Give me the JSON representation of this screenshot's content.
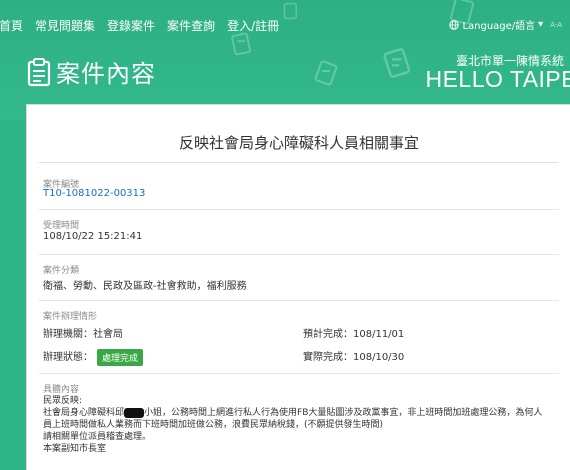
{
  "nav": {
    "items": [
      "首頁",
      "常見問題集",
      "登錄案件",
      "案件查詢",
      "登入/註冊"
    ],
    "language_label": "Language/語言",
    "language_arrow": "▾",
    "extra": "A-A"
  },
  "header": {
    "page_title": "案件內容",
    "city_small": "臺北市單一陳情系統",
    "city_big": "HELLO TAIPEI"
  },
  "case": {
    "title": "反映社會局身心障礙科人員相關事宜",
    "case_no_label": "案件編號",
    "case_no": "T10-1081022-00313",
    "received_label": "受理時間",
    "received": "108/10/22 15:21:41",
    "category_label": "案件分類",
    "category": "衛福、勞動、民政及區政-社會救助，福利服務",
    "handling_label": "案件辦理情形",
    "agency": "辦理機關：社會局",
    "planned": "預計完成：108/11/01",
    "status_label": "辦理狀態：",
    "status": "處理完成",
    "actual": "實際完成：108/10/30",
    "content_label": "具體內容",
    "content_lines": [
      "民眾反映:",
      "社會局身心障礙科邱",
      "小姐，公務時間上網進行私人行為使用FB大量貼圖涉及政黨事宜，非上班時間加班處理公務，為何人",
      "員上班時間做私人業務而下班時間加班做公務，浪費民眾納稅錢，(不願提供發生時間)",
      "請相關單位派員稽查處理。",
      "本案副知市長室"
    ]
  },
  "colors": {
    "brand_green": "#2fb487",
    "link_blue": "#1a6fc4",
    "badge_green": "#3aa745"
  }
}
